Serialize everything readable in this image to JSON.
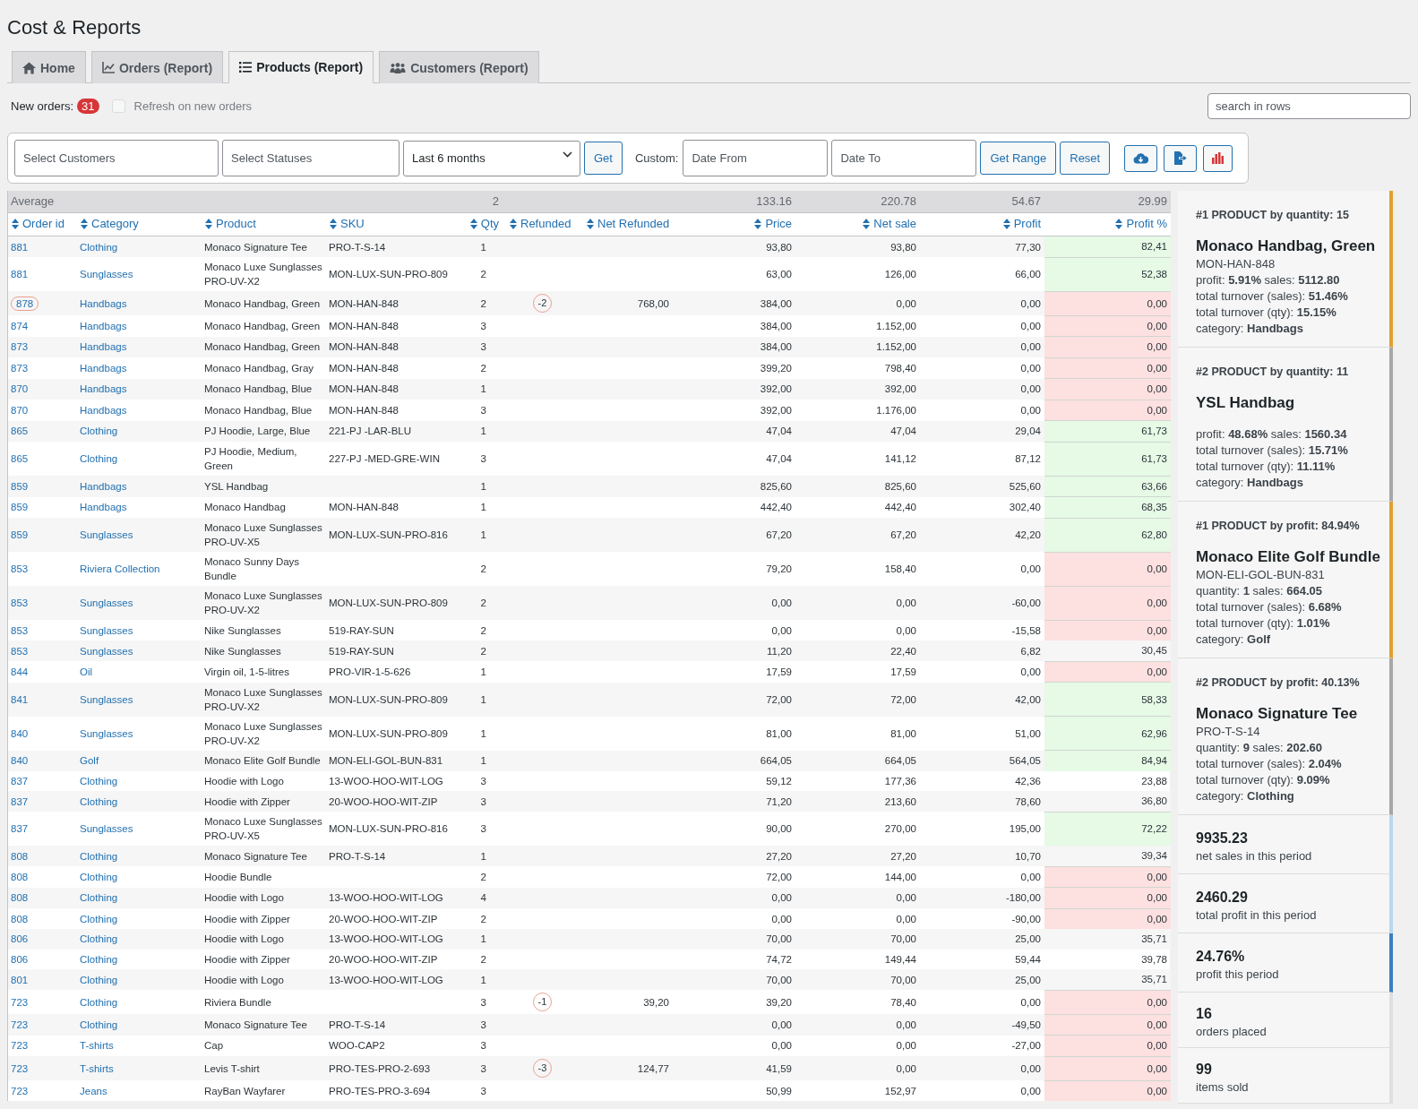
{
  "page": {
    "title": "Cost & Reports"
  },
  "tabs": [
    {
      "label": "Home",
      "selected": false
    },
    {
      "label": "Orders (Report)",
      "selected": false
    },
    {
      "label": "Products (Report)",
      "selected": true
    },
    {
      "label": "Customers (Report)",
      "selected": false
    }
  ],
  "notice": {
    "label": "New orders:",
    "count": "31",
    "refresh": {
      "label": "Refresh on new orders",
      "checked": false,
      "disabled": true
    }
  },
  "search": {
    "placeholder": "search in rows"
  },
  "filters": {
    "customers": {
      "placeholder": "Select Customers"
    },
    "statuses": {
      "placeholder": "Select Statuses"
    },
    "period": {
      "value": "Last 6 months"
    },
    "get": "Get",
    "custom_label": "Custom:",
    "date_from": {
      "placeholder": "Date From"
    },
    "date_to": {
      "placeholder": "Date To"
    },
    "get_range": "Get Range",
    "reset": "Reset"
  },
  "table": {
    "average": {
      "label": "Average",
      "qty": "2",
      "price": "133.16",
      "net_sale": "220.78",
      "profit": "54.67",
      "profit_pct": "29.99"
    },
    "columns": [
      "Order id",
      "Category",
      "Product",
      "SKU",
      "Qty",
      "Refunded",
      "Net Refunded",
      "Price",
      "Net sale",
      "Profit",
      "Profit %"
    ],
    "rows": [
      {
        "order": "881",
        "flagged": false,
        "category": "Clothing",
        "product": "Monaco Signature Tee",
        "sku": "PRO-T-S-14",
        "qty": "1",
        "price": "93,80",
        "net_sale": "93,80",
        "profit": "77,30",
        "profit_pct": "82,41",
        "color": "#e6fae6"
      },
      {
        "order": "881",
        "flagged": false,
        "category": "Sunglasses",
        "product": "Monaco Luxe Sunglasses PRO-UV-X2",
        "sku": "MON-LUX-SUN-PRO-809",
        "qty": "2",
        "price": "63,00",
        "net_sale": "126,00",
        "profit": "66,00",
        "profit_pct": "52,38",
        "color": "#e6fae6"
      },
      {
        "order": "878",
        "flagged": true,
        "category": "Handbags",
        "product": "Monaco Handbag, Green",
        "sku": "MON-HAN-848",
        "qty": "2",
        "refunded": "-2",
        "net_refunded": "768,00",
        "price": "384,00",
        "net_sale": "0,00",
        "profit": "0,00",
        "profit_pct": "0,00",
        "color": "#fde0e0"
      },
      {
        "order": "874",
        "flagged": false,
        "category": "Handbags",
        "product": "Monaco Handbag, Green",
        "sku": "MON-HAN-848",
        "qty": "3",
        "price": "384,00",
        "net_sale": "1.152,00",
        "profit": "0,00",
        "profit_pct": "0,00",
        "color": "#fde0e0"
      },
      {
        "order": "873",
        "flagged": false,
        "category": "Handbags",
        "product": "Monaco Handbag, Green",
        "sku": "MON-HAN-848",
        "qty": "3",
        "price": "384,00",
        "net_sale": "1.152,00",
        "profit": "0,00",
        "profit_pct": "0,00",
        "color": "#fde0e0"
      },
      {
        "order": "873",
        "flagged": false,
        "category": "Handbags",
        "product": "Monaco Handbag, Gray",
        "sku": "MON-HAN-848",
        "qty": "2",
        "price": "399,20",
        "net_sale": "798,40",
        "profit": "0,00",
        "profit_pct": "0,00",
        "color": "#fde0e0"
      },
      {
        "order": "870",
        "flagged": false,
        "category": "Handbags",
        "product": "Monaco Handbag, Blue",
        "sku": "MON-HAN-848",
        "qty": "1",
        "price": "392,00",
        "net_sale": "392,00",
        "profit": "0,00",
        "profit_pct": "0,00",
        "color": "#fde0e0"
      },
      {
        "order": "870",
        "flagged": false,
        "category": "Handbags",
        "product": "Monaco Handbag, Blue",
        "sku": "MON-HAN-848",
        "qty": "3",
        "price": "392,00",
        "net_sale": "1.176,00",
        "profit": "0,00",
        "profit_pct": "0,00",
        "color": "#fde0e0"
      },
      {
        "order": "865",
        "flagged": false,
        "category": "Clothing",
        "product": "PJ Hoodie, Large, Blue",
        "sku": "221-PJ -LAR-BLU",
        "qty": "1",
        "price": "47,04",
        "net_sale": "47,04",
        "profit": "29,04",
        "profit_pct": "61,73",
        "color": "#e6fae6"
      },
      {
        "order": "865",
        "flagged": false,
        "category": "Clothing",
        "product": "PJ Hoodie, Medium, Green",
        "sku": "227-PJ -MED-GRE-WIN",
        "qty": "3",
        "price": "47,04",
        "net_sale": "141,12",
        "profit": "87,12",
        "profit_pct": "61,73",
        "color": "#e6fae6"
      },
      {
        "order": "859",
        "flagged": false,
        "category": "Handbags",
        "product": "YSL Handbag",
        "qty": "1",
        "price": "825,60",
        "net_sale": "825,60",
        "profit": "525,60",
        "profit_pct": "63,66",
        "color": "#e6fae6"
      },
      {
        "order": "859",
        "flagged": false,
        "category": "Handbags",
        "product": "Monaco Handbag",
        "sku": "MON-HAN-848",
        "qty": "1",
        "price": "442,40",
        "net_sale": "442,40",
        "profit": "302,40",
        "profit_pct": "68,35",
        "color": "#e6fae6"
      },
      {
        "order": "859",
        "flagged": false,
        "category": "Sunglasses",
        "product": "Monaco Luxe Sunglasses PRO-UV-X5",
        "sku": "MON-LUX-SUN-PRO-816",
        "qty": "1",
        "price": "67,20",
        "net_sale": "67,20",
        "profit": "42,20",
        "profit_pct": "62,80",
        "color": "#e6fae6"
      },
      {
        "order": "853",
        "flagged": false,
        "category": "Riviera Collection",
        "product": "Monaco Sunny Days Bundle",
        "qty": "2",
        "price": "79,20",
        "net_sale": "158,40",
        "profit": "0,00",
        "profit_pct": "0,00",
        "color": "#fde0e0"
      },
      {
        "order": "853",
        "flagged": false,
        "category": "Sunglasses",
        "product": "Monaco Luxe Sunglasses PRO-UV-X2",
        "sku": "MON-LUX-SUN-PRO-809",
        "qty": "2",
        "price": "0,00",
        "net_sale": "0,00",
        "profit": "-60,00",
        "profit_pct": "0,00",
        "color": "#fde0e0"
      },
      {
        "order": "853",
        "flagged": false,
        "category": "Sunglasses",
        "product": "Nike Sunglasses",
        "sku": "519-RAY-SUN",
        "qty": "2",
        "price": "0,00",
        "net_sale": "0,00",
        "profit": "-15,58",
        "profit_pct": "0,00",
        "color": "#fde0e0"
      },
      {
        "order": "853",
        "flagged": false,
        "category": "Sunglasses",
        "product": "Nike Sunglasses",
        "sku": "519-RAY-SUN",
        "qty": "2",
        "price": "11,20",
        "net_sale": "22,40",
        "profit": "6,82",
        "profit_pct": "30,45"
      },
      {
        "order": "844",
        "flagged": false,
        "category": "Oil",
        "product": "Virgin oil, 1-5-litres",
        "sku": "PRO-VIR-1-5-626",
        "qty": "1",
        "price": "17,59",
        "net_sale": "17,59",
        "profit": "0,00",
        "profit_pct": "0,00",
        "color": "#fde0e0"
      },
      {
        "order": "841",
        "flagged": false,
        "category": "Sunglasses",
        "product": "Monaco Luxe Sunglasses PRO-UV-X2",
        "sku": "MON-LUX-SUN-PRO-809",
        "qty": "1",
        "price": "72,00",
        "net_sale": "72,00",
        "profit": "42,00",
        "profit_pct": "58,33",
        "color": "#e6fae6"
      },
      {
        "order": "840",
        "flagged": false,
        "category": "Sunglasses",
        "product": "Monaco Luxe Sunglasses PRO-UV-X2",
        "sku": "MON-LUX-SUN-PRO-809",
        "qty": "1",
        "price": "81,00",
        "net_sale": "81,00",
        "profit": "51,00",
        "profit_pct": "62,96",
        "color": "#e6fae6"
      },
      {
        "order": "840",
        "flagged": false,
        "category": "Golf",
        "product": "Monaco Elite Golf Bundle",
        "sku": "MON-ELI-GOL-BUN-831",
        "qty": "1",
        "price": "664,05",
        "net_sale": "664,05",
        "profit": "564,05",
        "profit_pct": "84,94",
        "color": "#e6fae6"
      },
      {
        "order": "837",
        "flagged": false,
        "category": "Clothing",
        "product": "Hoodie with Logo",
        "sku": "13-WOO-HOO-WIT-LOG",
        "qty": "3",
        "price": "59,12",
        "net_sale": "177,36",
        "profit": "42,36",
        "profit_pct": "23,88"
      },
      {
        "order": "837",
        "flagged": false,
        "category": "Clothing",
        "product": "Hoodie with Zipper",
        "sku": "20-WOO-HOO-WIT-ZIP",
        "qty": "3",
        "price": "71,20",
        "net_sale": "213,60",
        "profit": "78,60",
        "profit_pct": "36,80"
      },
      {
        "order": "837",
        "flagged": false,
        "category": "Sunglasses",
        "product": "Monaco Luxe Sunglasses PRO-UV-X5",
        "sku": "MON-LUX-SUN-PRO-816",
        "qty": "3",
        "price": "90,00",
        "net_sale": "270,00",
        "profit": "195,00",
        "profit_pct": "72,22",
        "color": "#e6fae6"
      },
      {
        "order": "808",
        "flagged": false,
        "category": "Clothing",
        "product": "Monaco Signature Tee",
        "sku": "PRO-T-S-14",
        "qty": "1",
        "price": "27,20",
        "net_sale": "27,20",
        "profit": "10,70",
        "profit_pct": "39,34"
      },
      {
        "order": "808",
        "flagged": false,
        "category": "Clothing",
        "product": "Hoodie Bundle",
        "qty": "2",
        "price": "72,00",
        "net_sale": "144,00",
        "profit": "0,00",
        "profit_pct": "0,00",
        "color": "#fde0e0"
      },
      {
        "order": "808",
        "flagged": false,
        "category": "Clothing",
        "product": "Hoodie with Logo",
        "sku": "13-WOO-HOO-WIT-LOG",
        "qty": "4",
        "price": "0,00",
        "net_sale": "0,00",
        "profit": "-180,00",
        "profit_pct": "0,00",
        "color": "#fde0e0"
      },
      {
        "order": "808",
        "flagged": false,
        "category": "Clothing",
        "product": "Hoodie with Zipper",
        "sku": "20-WOO-HOO-WIT-ZIP",
        "qty": "2",
        "price": "0,00",
        "net_sale": "0,00",
        "profit": "-90,00",
        "profit_pct": "0,00",
        "color": "#fde0e0"
      },
      {
        "order": "806",
        "flagged": false,
        "category": "Clothing",
        "product": "Hoodie with Logo",
        "sku": "13-WOO-HOO-WIT-LOG",
        "qty": "1",
        "price": "70,00",
        "net_sale": "70,00",
        "profit": "25,00",
        "profit_pct": "35,71"
      },
      {
        "order": "806",
        "flagged": false,
        "category": "Clothing",
        "product": "Hoodie with Zipper",
        "sku": "20-WOO-HOO-WIT-ZIP",
        "qty": "2",
        "price": "74,72",
        "net_sale": "149,44",
        "profit": "59,44",
        "profit_pct": "39,78"
      },
      {
        "order": "801",
        "flagged": false,
        "category": "Clothing",
        "product": "Hoodie with Logo",
        "sku": "13-WOO-HOO-WIT-LOG",
        "qty": "1",
        "price": "70,00",
        "net_sale": "70,00",
        "profit": "25,00",
        "profit_pct": "35,71"
      },
      {
        "order": "723",
        "flagged": false,
        "category": "Clothing",
        "product": "Riviera Bundle",
        "qty": "3",
        "refunded": "-1",
        "net_refunded": "39,20",
        "price": "39,20",
        "net_sale": "78,40",
        "profit": "0,00",
        "profit_pct": "0,00",
        "color": "#fde0e0"
      },
      {
        "order": "723",
        "flagged": false,
        "category": "Clothing",
        "product": "Monaco Signature Tee",
        "sku": "PRO-T-S-14",
        "qty": "3",
        "price": "0,00",
        "net_sale": "0,00",
        "profit": "-49,50",
        "profit_pct": "0,00",
        "color": "#fde0e0"
      },
      {
        "order": "723",
        "flagged": false,
        "category": "T-shirts",
        "product": "Cap",
        "sku": "WOO-CAP2",
        "qty": "3",
        "price": "0,00",
        "net_sale": "0,00",
        "profit": "-27,00",
        "profit_pct": "0,00",
        "color": "#fde0e0"
      },
      {
        "order": "723",
        "flagged": false,
        "category": "T-shirts",
        "product": "Levis T-shirt",
        "sku": "PRO-TES-PRO-2-693",
        "qty": "3",
        "refunded": "-3",
        "net_refunded": "124,77",
        "price": "41,59",
        "net_sale": "0,00",
        "profit": "0,00",
        "profit_pct": "0,00",
        "color": "#fde0e0"
      },
      {
        "order": "723",
        "flagged": false,
        "category": "Jeans",
        "product": "RayBan Wayfarer",
        "sku": "PRO-TES-PRO-3-694",
        "qty": "3",
        "price": "50,99",
        "net_sale": "152,97",
        "profit": "0,00",
        "profit_pct": "0,00",
        "color": "#fde0e0"
      }
    ]
  },
  "sidebar": {
    "cards": [
      {
        "kind": "product",
        "color": "#e0a030",
        "heading": "#1 PRODUCT by quantity: 15",
        "name": "Monaco Handbag, Green",
        "sku": "MON-HAN-848",
        "lines": [
          "profit: **5.91%** sales: **5112.80**",
          "total turnover (sales): **51.46%**",
          "total turnover (qty): **15.15%**",
          "category: **Handbags**"
        ]
      },
      {
        "kind": "product",
        "color": "#a7a7a7",
        "heading": "#2 PRODUCT by quantity: 11",
        "name": "YSL Handbag",
        "lines": [
          "profit: **48.68%** sales: **1560.34**",
          "total turnover (sales): **15.71%**",
          "total turnover (qty): **11.11%**",
          "category: **Handbags**"
        ]
      },
      {
        "kind": "product",
        "color": "#e0a030",
        "heading": "#1 PRODUCT by profit: 84.94%",
        "name": "Monaco Elite Golf Bundle",
        "sku": "MON-ELI-GOL-BUN-831",
        "lines": [
          "quantity: **1** sales: **664.05**",
          "total turnover (sales): **6.68%**",
          "total turnover (qty): **1.01%**",
          "category: **Golf**"
        ]
      },
      {
        "kind": "product",
        "color": "#a7a7a7",
        "heading": "#2 PRODUCT by profit: 40.13%",
        "name": "Monaco Signature Tee",
        "sku": "PRO-T-S-14",
        "lines": [
          "quantity: **9** sales: **202.60**",
          "total turnover (sales): **2.04%**",
          "total turnover (qty): **9.09%**",
          "category: **Clothing**"
        ]
      },
      {
        "kind": "stat",
        "color": "#b9d7ee",
        "value": "9935.23",
        "label": "net sales in this period"
      },
      {
        "kind": "stat",
        "color": "#b9d7ee",
        "value": "2460.29",
        "label": "total profit in this period"
      },
      {
        "kind": "stat",
        "color": "#3a7fc1",
        "value": "24.76%",
        "label": "profit this period"
      },
      {
        "kind": "stat",
        "color": "#dde0e3",
        "value": "16",
        "label": "orders placed"
      },
      {
        "kind": "stat",
        "color": "#dde0e3",
        "value": "99",
        "label": "items sold"
      }
    ]
  }
}
